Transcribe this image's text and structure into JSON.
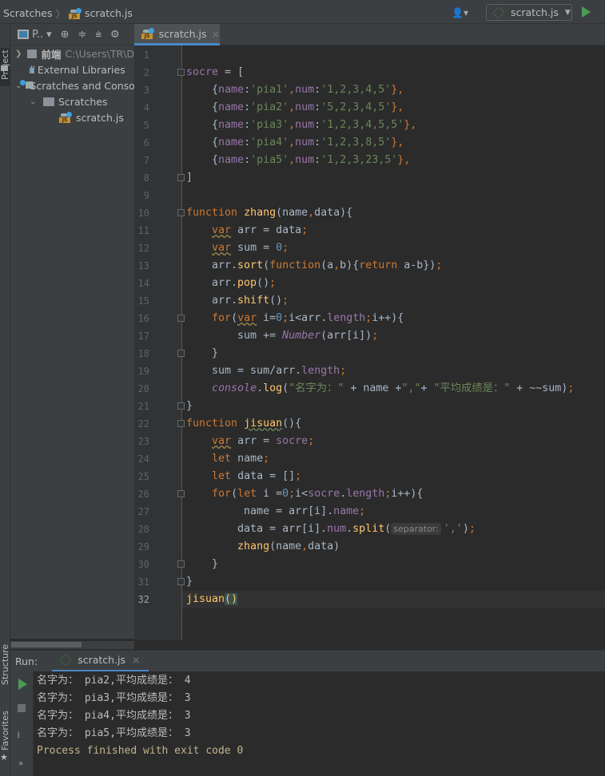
{
  "breadcrumb": {
    "root": "Scratches",
    "file": "scratch.js"
  },
  "toolbar": {
    "run_config": "scratch.js",
    "run": "run",
    "user": "user-icon"
  },
  "side_tabs": {
    "project": "Project",
    "structure": "Structure",
    "favorites": "Favorites"
  },
  "project": {
    "view_label": "P..",
    "tree": [
      {
        "label": "前端",
        "path": "C:\\Users\\TR\\D",
        "expanded": false
      },
      {
        "label": "External Libraries"
      },
      {
        "label": "Scratches and Consoles",
        "expanded": true
      },
      {
        "label": "Scratches",
        "expanded": true
      },
      {
        "label": "scratch.js"
      }
    ]
  },
  "editor": {
    "tab": "scratch.js",
    "current_line": 32,
    "lines": [
      [],
      [
        [
          "socre",
          "p"
        ],
        [
          " = ["
        ]
      ],
      [
        [
          "    {"
        ],
        [
          "name",
          "p"
        ],
        [
          ":"
        ],
        [
          "'pia1'",
          "s"
        ],
        [
          ",",
          "k"
        ],
        [
          "num",
          "p"
        ],
        [
          ":"
        ],
        [
          "'1,2,3,4,5'",
          "s"
        ],
        [
          "},",
          "k"
        ]
      ],
      [
        [
          "    {"
        ],
        [
          "name",
          "p"
        ],
        [
          ":"
        ],
        [
          "'pia2'",
          "s"
        ],
        [
          ",",
          "k"
        ],
        [
          "num",
          "p"
        ],
        [
          ":"
        ],
        [
          "'5,2,3,4,5'",
          "s"
        ],
        [
          "},",
          "k"
        ]
      ],
      [
        [
          "    {"
        ],
        [
          "name",
          "p"
        ],
        [
          ":"
        ],
        [
          "'pia3'",
          "s"
        ],
        [
          ",",
          "k"
        ],
        [
          "num",
          "p"
        ],
        [
          ":"
        ],
        [
          "'1,2,3,4,5,5'",
          "s"
        ],
        [
          "},",
          "k"
        ]
      ],
      [
        [
          "    {"
        ],
        [
          "name",
          "p"
        ],
        [
          ":"
        ],
        [
          "'pia4'",
          "s"
        ],
        [
          ",",
          "k"
        ],
        [
          "num",
          "p"
        ],
        [
          ":"
        ],
        [
          "'1,2,3,8,5'",
          "s"
        ],
        [
          "},",
          "k"
        ]
      ],
      [
        [
          "    {"
        ],
        [
          "name",
          "p"
        ],
        [
          ":"
        ],
        [
          "'pia5'",
          "s"
        ],
        [
          ",",
          "k"
        ],
        [
          "num",
          "p"
        ],
        [
          ":"
        ],
        [
          "'1,2,3,23,5'",
          "s"
        ],
        [
          "},",
          "k"
        ]
      ],
      [
        [
          "]"
        ]
      ],
      [],
      [
        [
          "function",
          "k"
        ],
        [
          " "
        ],
        [
          "zhang",
          "f"
        ],
        [
          "(name"
        ],
        [
          ",",
          "k"
        ],
        [
          "data){"
        ]
      ],
      [
        [
          "    "
        ],
        [
          "var",
          "k u"
        ],
        [
          " arr = data"
        ],
        [
          ";",
          "k"
        ]
      ],
      [
        [
          "    "
        ],
        [
          "var",
          "k u"
        ],
        [
          " sum = "
        ],
        [
          "0",
          "n"
        ],
        [
          ";",
          "k"
        ]
      ],
      [
        [
          "    arr."
        ],
        [
          "sort",
          "f"
        ],
        [
          "("
        ],
        [
          "function",
          "k"
        ],
        [
          "(a"
        ],
        [
          ",",
          "k"
        ],
        [
          "b){"
        ],
        [
          "return",
          "k"
        ],
        [
          " a-b})"
        ],
        [
          ";",
          "k"
        ]
      ],
      [
        [
          "    arr."
        ],
        [
          "pop",
          "f"
        ],
        [
          "()"
        ],
        [
          ";",
          "k"
        ]
      ],
      [
        [
          "    arr."
        ],
        [
          "shift",
          "f"
        ],
        [
          "()"
        ],
        [
          ";",
          "k"
        ]
      ],
      [
        [
          "    "
        ],
        [
          "for",
          "k"
        ],
        [
          "("
        ],
        [
          "var",
          "k u"
        ],
        [
          " i="
        ],
        [
          "0",
          "n"
        ],
        [
          ";",
          "k"
        ],
        [
          "i<arr."
        ],
        [
          "length",
          "p"
        ],
        [
          ";",
          "k"
        ],
        [
          "i++){"
        ]
      ],
      [
        [
          "        sum += "
        ],
        [
          "Number",
          "g"
        ],
        [
          "(arr[i])"
        ],
        [
          ";",
          "k"
        ]
      ],
      [
        [
          "    }"
        ]
      ],
      [
        [
          "    sum = sum/arr."
        ],
        [
          "length",
          "p"
        ],
        [
          ";",
          "k"
        ]
      ],
      [
        [
          "    "
        ],
        [
          "console",
          "g"
        ],
        [
          "."
        ],
        [
          "log",
          "f"
        ],
        [
          "("
        ],
        [
          "\"名字为：\"",
          "s"
        ],
        [
          " + name +"
        ],
        [
          "\",\"",
          "s"
        ],
        [
          "+ "
        ],
        [
          "\"平均成绩是：\"",
          "s"
        ],
        [
          " + ~~sum)"
        ],
        [
          ";",
          "k"
        ]
      ],
      [
        [
          "}"
        ]
      ],
      [
        [
          "function",
          "k"
        ],
        [
          " "
        ],
        [
          "jisuan",
          "f w"
        ],
        [
          "(){"
        ]
      ],
      [
        [
          "    "
        ],
        [
          "var",
          "k u"
        ],
        [
          " arr = "
        ],
        [
          "socre",
          "p"
        ],
        [
          ";",
          "k"
        ]
      ],
      [
        [
          "    "
        ],
        [
          "let",
          "k"
        ],
        [
          " name"
        ],
        [
          ";",
          "k"
        ]
      ],
      [
        [
          "    "
        ],
        [
          "let",
          "k"
        ],
        [
          " data = []"
        ],
        [
          ";",
          "k"
        ]
      ],
      [
        [
          "    "
        ],
        [
          "for",
          "k"
        ],
        [
          "("
        ],
        [
          "let",
          "k"
        ],
        [
          " i ="
        ],
        [
          "0",
          "n"
        ],
        [
          ";",
          "k"
        ],
        [
          "i<"
        ],
        [
          "socre",
          "p"
        ],
        [
          "."
        ],
        [
          "length",
          "p"
        ],
        [
          ";",
          "k"
        ],
        [
          "i++){"
        ]
      ],
      [
        [
          "         name = arr[i]."
        ],
        [
          "name",
          "p"
        ],
        [
          ";",
          "k"
        ]
      ],
      [
        [
          "        data = arr[i]."
        ],
        [
          "num",
          "p"
        ],
        [
          "."
        ],
        [
          "split",
          "f"
        ],
        [
          "("
        ],
        [
          "separator:",
          "h"
        ],
        [
          "','",
          "s"
        ],
        [
          ")"
        ],
        [
          ";",
          "k"
        ]
      ],
      [
        [
          "        "
        ],
        [
          "zhang",
          "f"
        ],
        [
          "(name"
        ],
        [
          ",",
          "k"
        ],
        [
          "data)"
        ]
      ],
      [
        [
          "    }"
        ]
      ],
      [
        [
          "}"
        ]
      ],
      [
        [
          "jisuan",
          "f"
        ],
        [
          "(",
          "f m"
        ],
        [
          ")",
          "f m"
        ]
      ]
    ]
  },
  "run": {
    "label": "Run:",
    "tab": "scratch.js",
    "output": [
      "名字为： pia2,平均成绩是： 4",
      "名字为： pia3,平均成绩是： 3",
      "名字为： pia4,平均成绩是： 3",
      "名字为： pia5,平均成绩是： 3"
    ],
    "exit": "Process finished with exit code 0"
  }
}
